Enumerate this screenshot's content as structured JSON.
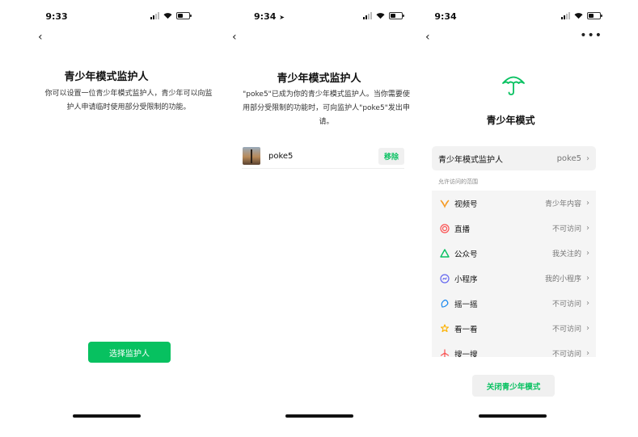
{
  "screen1": {
    "status": {
      "time": "9:33"
    },
    "title": "青少年模式监护人",
    "description": "你可以设置一位青少年模式监护人，青少年可以向监护人申请临时使用部分受限制的功能。",
    "button": "选择监护人"
  },
  "screen2": {
    "status": {
      "time": "9:34"
    },
    "title": "青少年模式监护人",
    "description": "\"poke5\"已成为你的青少年模式监护人。当你需要使用部分受限制的功能时，可向监护人\"poke5\"发出申请。",
    "guardian": {
      "name": "poke5",
      "remove_label": "移除"
    }
  },
  "screen3": {
    "status": {
      "time": "9:34"
    },
    "title": "青少年模式",
    "guardian_row": {
      "label": "青少年模式监护人",
      "value": "poke5"
    },
    "section_header": "允许访问的范围",
    "items": [
      {
        "label": "视频号",
        "value": "青少年内容",
        "icon": "channels-icon",
        "color": "#f59a23"
      },
      {
        "label": "直播",
        "value": "不可访问",
        "icon": "live-icon",
        "color": "#fa5151"
      },
      {
        "label": "公众号",
        "value": "我关注的",
        "icon": "official-account-icon",
        "color": "#07c160"
      },
      {
        "label": "小程序",
        "value": "我的小程序",
        "icon": "mini-program-icon",
        "color": "#6467f0"
      },
      {
        "label": "摇一摇",
        "value": "不可访问",
        "icon": "shake-icon",
        "color": "#1485ee"
      },
      {
        "label": "看一看",
        "value": "不可访问",
        "icon": "top-stories-icon",
        "color": "#fcb100"
      },
      {
        "label": "搜一搜",
        "value": "不可访问",
        "icon": "search-icon",
        "color": "#fa5151"
      }
    ],
    "close_button": "关闭青少年模式"
  },
  "colors": {
    "accent": "#07c160"
  }
}
